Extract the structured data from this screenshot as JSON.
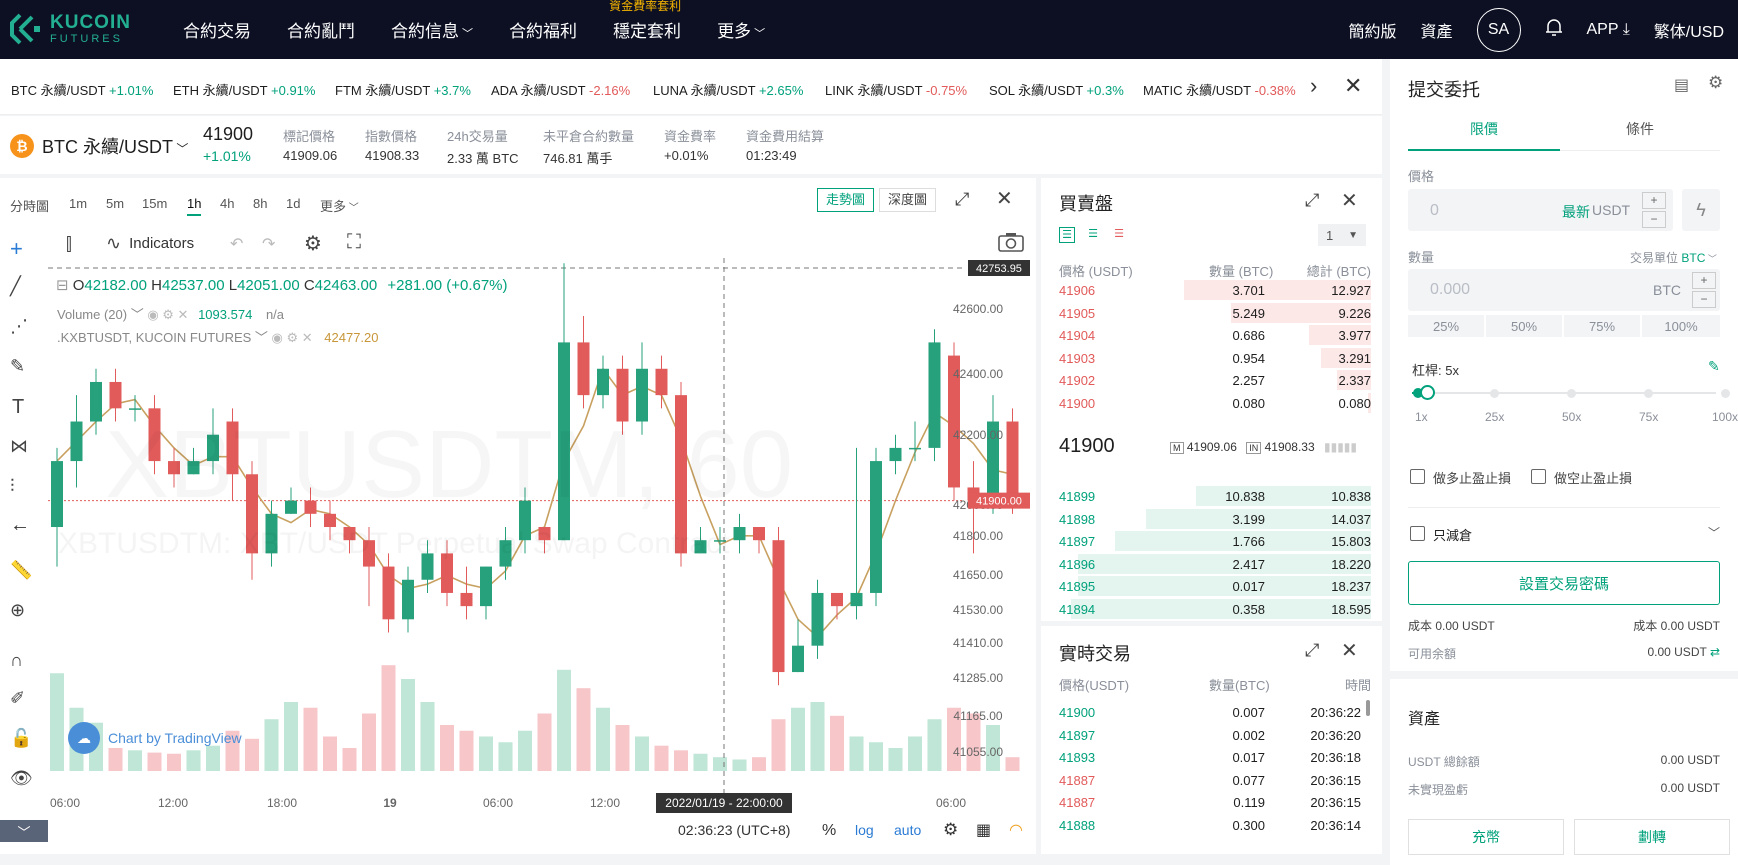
{
  "nav": {
    "brand": "KUCOIN",
    "brand_sub": "FUTURES",
    "items": [
      "合約交易",
      "合約亂鬥",
      "合約信息",
      "合約福利",
      "穩定套利",
      "更多"
    ],
    "stable_badge": "資金費率套利",
    "right": [
      "簡約版",
      "資產"
    ],
    "avatar": "SA",
    "app": "APP",
    "locale": "繁体/USD"
  },
  "ticker": [
    {
      "sym": "BTC 永續/USDT",
      "chg": "+1.01%",
      "dir": "up"
    },
    {
      "sym": "ETH 永續/USDT",
      "chg": "+0.91%",
      "dir": "up"
    },
    {
      "sym": "FTM 永續/USDT",
      "chg": "+3.7%",
      "dir": "up"
    },
    {
      "sym": "ADA 永續/USDT",
      "chg": "-2.16%",
      "dir": "down"
    },
    {
      "sym": "LUNA 永續/USDT",
      "chg": "+2.65%",
      "dir": "up"
    },
    {
      "sym": "LINK 永續/USDT",
      "chg": "-0.75%",
      "dir": "down"
    },
    {
      "sym": "SOL 永續/USDT",
      "chg": "+0.3%",
      "dir": "up"
    },
    {
      "sym": "MATIC 永續/USDT",
      "chg": "-0.38%",
      "dir": "down"
    }
  ],
  "info": {
    "symbol": "BTC 永續/USDT",
    "price": "41900",
    "change": "+1.01%",
    "stats": [
      {
        "label": "標記價格",
        "value": "41909.06"
      },
      {
        "label": "指數價格",
        "value": "41908.33"
      },
      {
        "label": "24h交易量",
        "value": "2.33 萬 BTC"
      },
      {
        "label": "未平倉合約數量",
        "value": "746.81 萬手"
      },
      {
        "label": "資金費率",
        "value": "+0.01%"
      },
      {
        "label": "資金費用結算",
        "value": "01:23:49"
      }
    ]
  },
  "chart": {
    "timeframes": [
      "分時圖",
      "1m",
      "5m",
      "15m",
      "1h",
      "4h",
      "8h",
      "1d",
      "更多"
    ],
    "active_tf": "1h",
    "view_tabs": [
      "走勢圖",
      "深度圖"
    ],
    "indicators_label": "Indicators",
    "ohlc": {
      "o": "42182.00",
      "h": "42537.00",
      "l": "42051.00",
      "c": "42463.00",
      "chg": "+281.00 (+0.67%)"
    },
    "volume_label": "Volume (20)",
    "volume_value": "1093.574",
    "volume_na": "n/a",
    "index_label": ".KXBTUSDT, KUCOIN FUTURES",
    "index_value": "42477.20",
    "watermark_big": "XBTUSDTM, 60",
    "watermark_sub": "XBTUSDTM: XBT/USDT Perpetual Swap Contract",
    "tradingview": "Chart by TradingView",
    "price_ticks": [
      "42600.00",
      "42400.00",
      "42200.00",
      "42000.00",
      "41800.00",
      "41650.00",
      "41530.00",
      "41410.00",
      "41285.00",
      "41165.00",
      "41055.00"
    ],
    "crosshair_price": "42753.95",
    "last_price_tag": "41900.00",
    "time_ticks": [
      "06:00",
      "12:00",
      "18:00",
      "19",
      "06:00",
      "12:00",
      "18",
      "06:00"
    ],
    "crosshair_time": "2022/01/19 - 22:00:00",
    "clock": "02:36:23 (UTC+8)",
    "bottom_opts": [
      "%",
      "log",
      "auto"
    ]
  },
  "chart_data": {
    "type": "candlestick",
    "ylim": [
      41000,
      42820
    ],
    "candles": [
      [
        41800,
        42050,
        42100,
        41650
      ],
      [
        42050,
        42200,
        42300,
        41950
      ],
      [
        42200,
        42350,
        42400,
        42150
      ],
      [
        42350,
        42250,
        42400,
        42200
      ],
      [
        42250,
        42250,
        42300,
        42200
      ],
      [
        42250,
        42050,
        42300,
        42000
      ],
      [
        42050,
        42000,
        42100,
        41950
      ],
      [
        42000,
        42050,
        42100,
        42000
      ],
      [
        42050,
        42150,
        42250,
        42000
      ],
      [
        42200,
        42000,
        42250,
        41900
      ],
      [
        42000,
        41700,
        42050,
        41600
      ],
      [
        41700,
        41850,
        41900,
        41650
      ],
      [
        41850,
        41900,
        41950,
        41850
      ],
      [
        41900,
        41850,
        41950,
        41800
      ],
      [
        41850,
        41800,
        41900,
        41750
      ],
      [
        41800,
        41750,
        41800,
        41700
      ],
      [
        41750,
        41650,
        41800,
        41500
      ],
      [
        41650,
        41450,
        41700,
        41400
      ],
      [
        41450,
        41600,
        41650,
        41400
      ],
      [
        41600,
        41700,
        41750,
        41550
      ],
      [
        41700,
        41550,
        41750,
        41500
      ],
      [
        41550,
        41500,
        41650,
        41450
      ],
      [
        41500,
        41650,
        41650,
        41450
      ],
      [
        41650,
        41750,
        41800,
        41600
      ],
      [
        41750,
        41900,
        41950,
        41700
      ],
      [
        41800,
        41750,
        41800,
        41700
      ],
      [
        41750,
        42500,
        42800,
        41750
      ],
      [
        42500,
        42300,
        42600,
        42250
      ],
      [
        42300,
        42400,
        42450,
        42250
      ],
      [
        42400,
        42200,
        42450,
        42150
      ],
      [
        42200,
        42400,
        42500,
        42150
      ],
      [
        42400,
        42300,
        42450,
        42250
      ],
      [
        42300,
        41700,
        42350,
        41650
      ],
      [
        41700,
        41750,
        41800,
        41700
      ],
      [
        41750,
        41750,
        41800,
        41700
      ],
      [
        41750,
        41800,
        41850,
        41700
      ],
      [
        41800,
        41750,
        41800,
        41700
      ],
      [
        41750,
        41250,
        41800,
        41200
      ],
      [
        41250,
        41350,
        41450,
        41250
      ],
      [
        41350,
        41550,
        41600,
        41300
      ],
      [
        41550,
        41500,
        41550,
        41450
      ],
      [
        41500,
        41550,
        42100,
        41450
      ],
      [
        41550,
        42050,
        42100,
        41500
      ],
      [
        42050,
        42100,
        42150,
        42000
      ],
      [
        42100,
        42100,
        42200,
        42050
      ],
      [
        42100,
        42500,
        42550,
        42050
      ],
      [
        42450,
        41950,
        42500,
        41900
      ],
      [
        41950,
        41900,
        42050,
        41700
      ],
      [
        41900,
        42200,
        42300,
        41850
      ],
      [
        42200,
        41900,
        42250,
        41850
      ]
    ],
    "volumes": [
      0.85,
      0.55,
      0.42,
      0.2,
      0.18,
      0.16,
      0.15,
      0.18,
      0.22,
      0.35,
      0.28,
      0.45,
      0.6,
      0.55,
      0.3,
      0.2,
      0.5,
      0.92,
      0.8,
      0.6,
      0.4,
      0.35,
      0.3,
      0.25,
      0.35,
      0.5,
      0.88,
      0.72,
      0.55,
      0.4,
      0.3,
      0.22,
      0.18,
      0.15,
      0.12,
      0.1,
      0.12,
      0.45,
      0.55,
      0.6,
      0.48,
      0.3,
      0.25,
      0.2,
      0.3,
      0.45,
      0.55,
      0.5,
      0.4,
      0.12
    ]
  },
  "orderbook": {
    "title": "買賣盤",
    "depth_select": "1",
    "headers": [
      "價格 (USDT)",
      "數量 (BTC)",
      "總計 (BTC)"
    ],
    "asks": [
      {
        "price": "41906",
        "qty": "3.701",
        "total": "12.927",
        "bar": 0.6
      },
      {
        "price": "41905",
        "qty": "5.249",
        "total": "9.226",
        "bar": 0.45
      },
      {
        "price": "41904",
        "qty": "0.686",
        "total": "3.977",
        "bar": 0.2
      },
      {
        "price": "41903",
        "qty": "0.954",
        "total": "3.291",
        "bar": 0.16
      },
      {
        "price": "41902",
        "qty": "2.257",
        "total": "2.337",
        "bar": 0.11
      },
      {
        "price": "41900",
        "qty": "0.080",
        "total": "0.080",
        "bar": 0.01
      }
    ],
    "mid_price": "41900",
    "mark": "41909.06",
    "index": "41908.33",
    "bids": [
      {
        "price": "41899",
        "qty": "10.838",
        "total": "10.838",
        "bar": 0.56
      },
      {
        "price": "41898",
        "qty": "3.199",
        "total": "14.037",
        "bar": 0.72
      },
      {
        "price": "41897",
        "qty": "1.766",
        "total": "15.803",
        "bar": 0.82
      },
      {
        "price": "41896",
        "qty": "2.417",
        "total": "18.220",
        "bar": 0.94
      },
      {
        "price": "41895",
        "qty": "0.017",
        "total": "18.237",
        "bar": 0.94
      },
      {
        "price": "41894",
        "qty": "0.358",
        "total": "18.595",
        "bar": 0.96
      }
    ]
  },
  "trades": {
    "title": "實時交易",
    "headers": [
      "價格(USDT)",
      "數量(BTC)",
      "時間"
    ],
    "rows": [
      {
        "price": "41900",
        "qty": "0.007",
        "time": "20:36:22",
        "dir": "up"
      },
      {
        "price": "41897",
        "qty": "0.002",
        "time": "20:36:20",
        "dir": "up"
      },
      {
        "price": "41893",
        "qty": "0.017",
        "time": "20:36:18",
        "dir": "up"
      },
      {
        "price": "41887",
        "qty": "0.077",
        "time": "20:36:15",
        "dir": "down"
      },
      {
        "price": "41887",
        "qty": "0.119",
        "time": "20:36:15",
        "dir": "down"
      },
      {
        "price": "41888",
        "qty": "0.300",
        "time": "20:36:14",
        "dir": "up"
      }
    ]
  },
  "order": {
    "title": "提交委托",
    "tabs": [
      "限價",
      "條件"
    ],
    "price_label": "價格",
    "price_placeholder": "0",
    "latest": "最新",
    "usdt": "USDT",
    "qty_label": "數量",
    "unit_label": "交易單位",
    "unit_value": "BTC",
    "qty_placeholder": "0.000",
    "qty_unit": "BTC",
    "pcts": [
      "25%",
      "50%",
      "75%",
      "100%"
    ],
    "leverage_label": "杠桿: 5x",
    "leverage_marks": [
      "1x",
      "25x",
      "50x",
      "75x",
      "100x"
    ],
    "tp_long": "做多止盈止損",
    "tp_short": "做空止盈止損",
    "reduce_only": "只減倉",
    "set_password": "設置交易密碼",
    "cost_left": "成本 0.00 USDT",
    "cost_right": "成本 0.00 USDT",
    "available_label": "可用余額",
    "available_value": "0.00 USDT",
    "assets_title": "資產",
    "balance_label": "USDT 總餘額",
    "balance_value": "0.00 USDT",
    "pnl_label": "未實現盈虧",
    "pnl_value": "0.00 USDT",
    "deposit": "充幣",
    "transfer": "劃轉"
  },
  "colors": {
    "up": "#26a17b",
    "down": "#e15b5b",
    "brand": "#01a17c",
    "nav": "#0d1023"
  }
}
